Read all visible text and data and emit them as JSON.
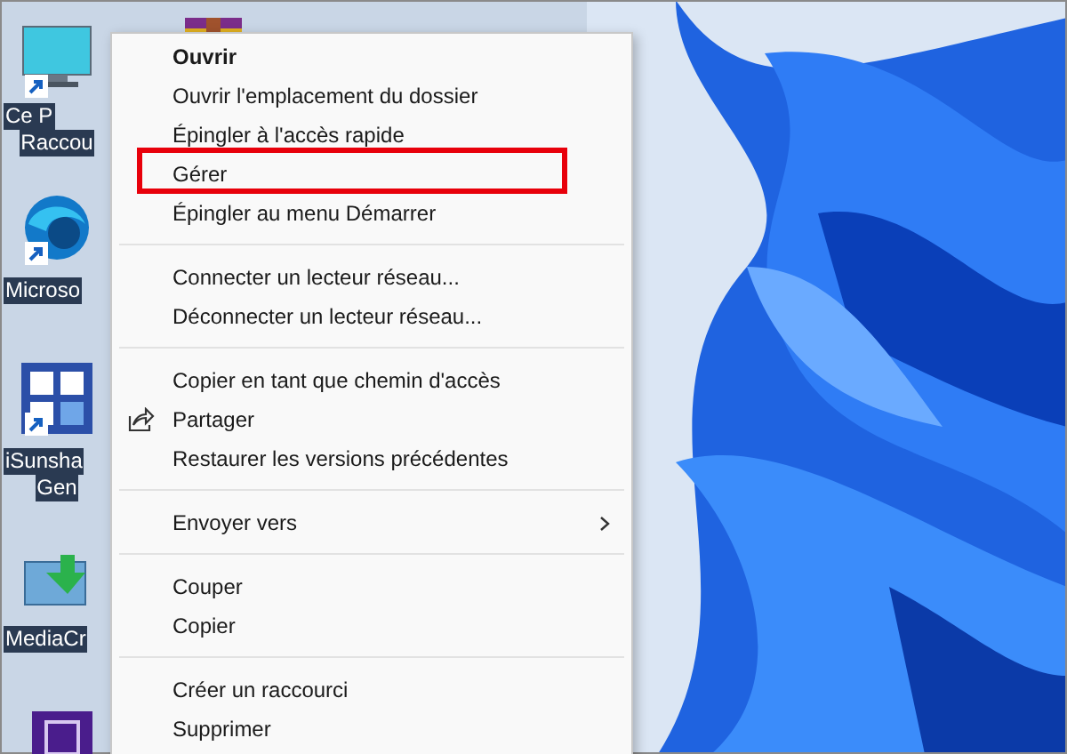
{
  "desktop_icons": [
    {
      "kind": "computer",
      "lines": [
        "Ce P",
        "Raccou"
      ],
      "shortcut": true
    },
    {
      "kind": "edge",
      "lines": [
        "Microso"
      ],
      "shortcut": true
    },
    {
      "kind": "grid",
      "lines": [
        "iSunsha",
        "Gen"
      ],
      "shortcut": true
    },
    {
      "kind": "media",
      "lines": [
        "MediaCr"
      ]
    },
    {
      "kind": "chip"
    },
    {
      "kind": "archive"
    }
  ],
  "context_menu": {
    "groups": [
      [
        {
          "label": "Ouvrir",
          "kind": "plain",
          "default": true,
          "highlighted": false
        },
        {
          "label": "Ouvrir l'emplacement du dossier",
          "kind": "plain",
          "default": false,
          "highlighted": false
        },
        {
          "label": "Épingler à l'accès rapide",
          "kind": "plain",
          "default": false,
          "highlighted": false
        },
        {
          "label": "Gérer",
          "kind": "plain",
          "default": false,
          "highlighted": true
        },
        {
          "label": "Épingler au menu Démarrer",
          "kind": "plain",
          "default": false,
          "highlighted": false
        }
      ],
      [
        {
          "label": "Connecter un lecteur réseau...",
          "kind": "plain",
          "default": false,
          "highlighted": false
        },
        {
          "label": "Déconnecter un lecteur réseau...",
          "kind": "plain",
          "default": false,
          "highlighted": false
        }
      ],
      [
        {
          "label": "Copier en tant que chemin d'accès",
          "kind": "plain",
          "default": false,
          "highlighted": false
        },
        {
          "label": "Partager",
          "kind": "share",
          "default": false,
          "highlighted": false
        },
        {
          "label": "Restaurer les versions précédentes",
          "kind": "plain",
          "default": false,
          "highlighted": false
        }
      ],
      [
        {
          "label": "Envoyer vers",
          "kind": "submenu",
          "default": false,
          "highlighted": false
        }
      ],
      [
        {
          "label": "Couper",
          "kind": "plain",
          "default": false,
          "highlighted": false
        },
        {
          "label": "Copier",
          "kind": "plain",
          "default": false,
          "highlighted": false
        }
      ],
      [
        {
          "label": "Créer un raccourci",
          "kind": "plain",
          "default": false,
          "highlighted": false
        },
        {
          "label": "Supprimer",
          "kind": "plain",
          "default": false,
          "highlighted": false
        }
      ]
    ]
  }
}
